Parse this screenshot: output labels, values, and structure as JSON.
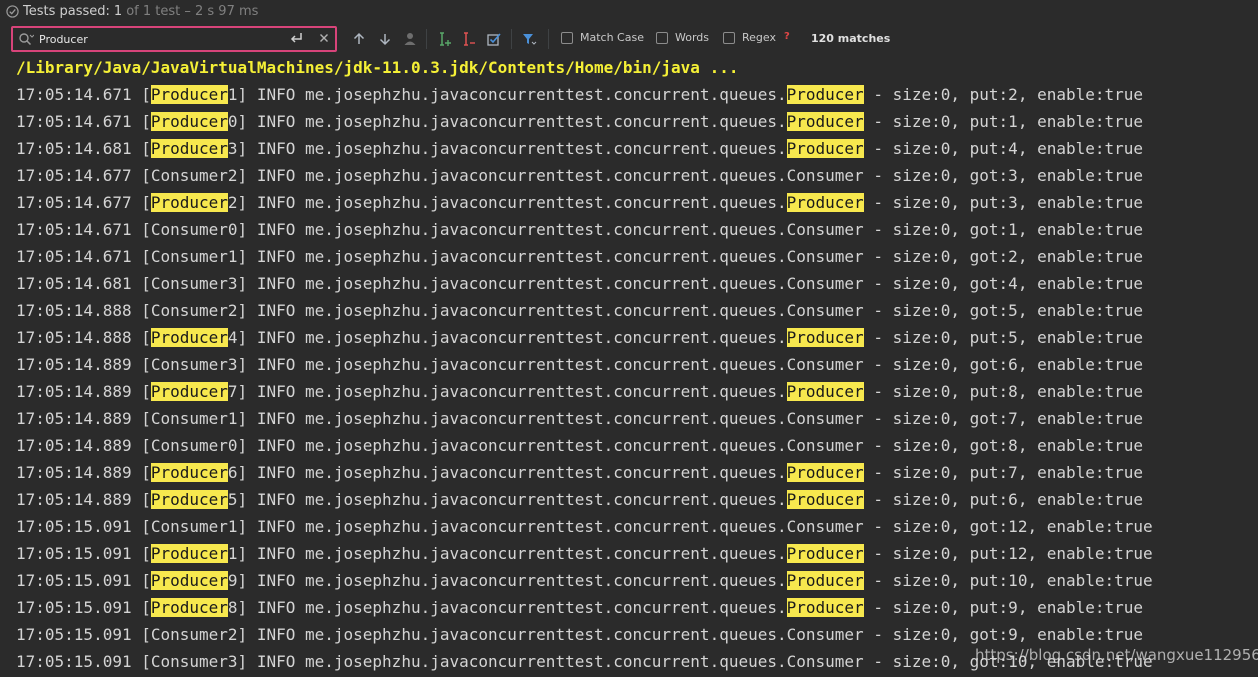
{
  "status": {
    "passed_label": "Tests passed:",
    "count": "1",
    "rest": "of 1 test – 2 s 97 ms"
  },
  "search": {
    "value": "Producer",
    "options": {
      "match_case": "Match Case",
      "words": "Words",
      "regex": "Regex",
      "regex_help": "?"
    },
    "matches": "120 matches"
  },
  "console": {
    "command": "/Library/Java/JavaVirtualMachines/jdk-11.0.3.jdk/Contents/Home/bin/java ...",
    "highlight_term": "Producer",
    "lines": [
      "17:05:14.671 [Producer1] INFO me.josephzhu.javaconcurrenttest.concurrent.queues.Producer - size:0, put:2, enable:true",
      "17:05:14.671 [Producer0] INFO me.josephzhu.javaconcurrenttest.concurrent.queues.Producer - size:0, put:1, enable:true",
      "17:05:14.681 [Producer3] INFO me.josephzhu.javaconcurrenttest.concurrent.queues.Producer - size:0, put:4, enable:true",
      "17:05:14.677 [Consumer2] INFO me.josephzhu.javaconcurrenttest.concurrent.queues.Consumer - size:0, got:3, enable:true",
      "17:05:14.677 [Producer2] INFO me.josephzhu.javaconcurrenttest.concurrent.queues.Producer - size:0, put:3, enable:true",
      "17:05:14.671 [Consumer0] INFO me.josephzhu.javaconcurrenttest.concurrent.queues.Consumer - size:0, got:1, enable:true",
      "17:05:14.671 [Consumer1] INFO me.josephzhu.javaconcurrenttest.concurrent.queues.Consumer - size:0, got:2, enable:true",
      "17:05:14.681 [Consumer3] INFO me.josephzhu.javaconcurrenttest.concurrent.queues.Consumer - size:0, got:4, enable:true",
      "17:05:14.888 [Consumer2] INFO me.josephzhu.javaconcurrenttest.concurrent.queues.Consumer - size:0, got:5, enable:true",
      "17:05:14.888 [Producer4] INFO me.josephzhu.javaconcurrenttest.concurrent.queues.Producer - size:0, put:5, enable:true",
      "17:05:14.889 [Consumer3] INFO me.josephzhu.javaconcurrenttest.concurrent.queues.Consumer - size:0, got:6, enable:true",
      "17:05:14.889 [Producer7] INFO me.josephzhu.javaconcurrenttest.concurrent.queues.Producer - size:0, put:8, enable:true",
      "17:05:14.889 [Consumer1] INFO me.josephzhu.javaconcurrenttest.concurrent.queues.Consumer - size:0, got:7, enable:true",
      "17:05:14.889 [Consumer0] INFO me.josephzhu.javaconcurrenttest.concurrent.queues.Consumer - size:0, got:8, enable:true",
      "17:05:14.889 [Producer6] INFO me.josephzhu.javaconcurrenttest.concurrent.queues.Producer - size:0, put:7, enable:true",
      "17:05:14.889 [Producer5] INFO me.josephzhu.javaconcurrenttest.concurrent.queues.Producer - size:0, put:6, enable:true",
      "17:05:15.091 [Consumer1] INFO me.josephzhu.javaconcurrenttest.concurrent.queues.Consumer - size:0, got:12, enable:true",
      "17:05:15.091 [Producer1] INFO me.josephzhu.javaconcurrenttest.concurrent.queues.Producer - size:0, put:12, enable:true",
      "17:05:15.091 [Producer9] INFO me.josephzhu.javaconcurrenttest.concurrent.queues.Producer - size:0, put:10, enable:true",
      "17:05:15.091 [Producer8] INFO me.josephzhu.javaconcurrenttest.concurrent.queues.Producer - size:0, put:9, enable:true",
      "17:05:15.091 [Consumer2] INFO me.josephzhu.javaconcurrenttest.concurrent.queues.Consumer - size:0, got:9, enable:true",
      "17:05:15.091 [Consumer3] INFO me.josephzhu.javaconcurrenttest.concurrent.queues.Consumer - size:0, got:10, enable:true"
    ]
  },
  "watermark": "https://blog.csdn.net/wangxue112956",
  "colors": {
    "background": "#2b2b2b",
    "highlight": "#f7e84e",
    "command": "#f5f036",
    "search_border": "#d8447a",
    "accent_blue": "#4a90d9",
    "pass_green": "#59a869"
  }
}
